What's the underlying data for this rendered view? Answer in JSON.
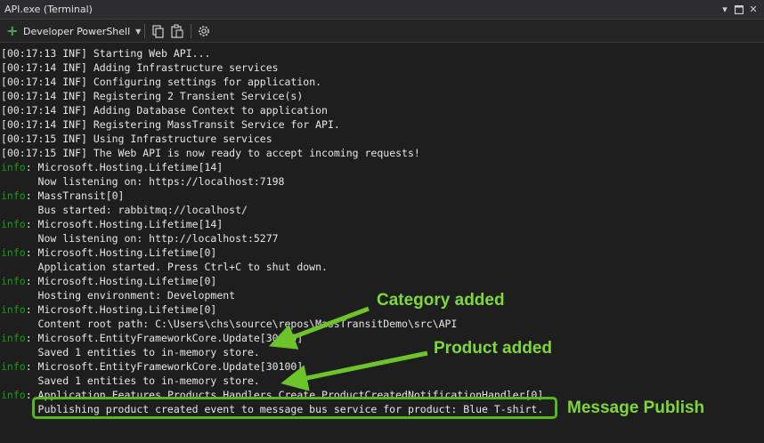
{
  "window": {
    "title": "API.exe (Terminal)",
    "controls": [
      "dropdown",
      "maximize",
      "close"
    ]
  },
  "toolbar": {
    "profile_label": "Developer PowerShell",
    "icons": [
      "copy-icon",
      "paste-icon",
      "settings-icon"
    ]
  },
  "console": {
    "lines": [
      {
        "prefix": "[",
        "text": "00:17:13 INF] Starting Web API..."
      },
      {
        "prefix": "[",
        "text": "00:17:14 INF] Adding Infrastructure services"
      },
      {
        "prefix": "[",
        "text": "00:17:14 INF] Configuring settings for application."
      },
      {
        "prefix": "[",
        "text": "00:17:14 INF] Registering 2 Transient Service(s)"
      },
      {
        "prefix": "[",
        "text": "00:17:14 INF] Adding Database Context to application"
      },
      {
        "prefix": "[",
        "text": "00:17:14 INF] Registering MassTransit Service for API."
      },
      {
        "prefix": "[",
        "text": "00:17:15 INF] Using Infrastructure services"
      },
      {
        "prefix": "[",
        "text": "00:17:15 INF] The Web API is now ready to accept incoming requests!"
      },
      {
        "prefix": "info",
        "text": ": Microsoft.Hosting.Lifetime[14]"
      },
      {
        "prefix": "",
        "text": "      Now listening on: https://localhost:7198"
      },
      {
        "prefix": "info",
        "text": ": MassTransit[0]"
      },
      {
        "prefix": "",
        "text": "      Bus started: rabbitmq://localhost/"
      },
      {
        "prefix": "info",
        "text": ": Microsoft.Hosting.Lifetime[14]"
      },
      {
        "prefix": "",
        "text": "      Now listening on: http://localhost:5277"
      },
      {
        "prefix": "info",
        "text": ": Microsoft.Hosting.Lifetime[0]"
      },
      {
        "prefix": "",
        "text": "      Application started. Press Ctrl+C to shut down."
      },
      {
        "prefix": "info",
        "text": ": Microsoft.Hosting.Lifetime[0]"
      },
      {
        "prefix": "",
        "text": "      Hosting environment: Development"
      },
      {
        "prefix": "info",
        "text": ": Microsoft.Hosting.Lifetime[0]"
      },
      {
        "prefix": "",
        "text": "      Content root path: C:\\Users\\chs\\source\\repos\\MassTransitDemo\\src\\API"
      },
      {
        "prefix": "info",
        "text": ": Microsoft.EntityFrameworkCore.Update[30100]"
      },
      {
        "prefix": "",
        "text": "      Saved 1 entities to in-memory store."
      },
      {
        "prefix": "info",
        "text": ": Microsoft.EntityFrameworkCore.Update[30100]"
      },
      {
        "prefix": "",
        "text": "      Saved 1 entities to in-memory store."
      },
      {
        "prefix": "info",
        "text": ": Application.Features.Products.Handlers.Create.ProductCreatedNotificationHandler[0]"
      },
      {
        "prefix": "",
        "text": "      Publishing product created event to message bus service for product: Blue T-shirt."
      }
    ]
  },
  "annotations": {
    "category": "Category added",
    "product": "Product added",
    "message": "Message Publish",
    "color": "#7fd83a"
  }
}
